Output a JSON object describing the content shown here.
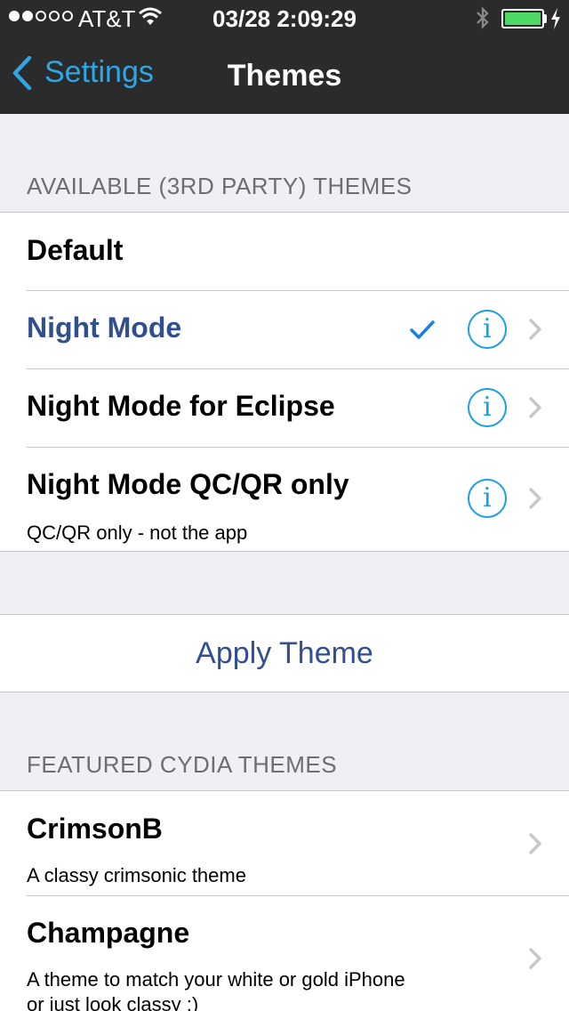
{
  "status": {
    "carrier": "AT&T",
    "time": "03/28 2:09:29",
    "signal_bars_filled": 2,
    "signal_bars_total": 5,
    "battery_level": 1.0
  },
  "nav": {
    "back_label": "Settings",
    "title": "Themes"
  },
  "available": {
    "header": "AVAILABLE (3RD PARTY) THEMES",
    "items": [
      {
        "title": "Default",
        "subtitle": "",
        "selected": false,
        "info": false
      },
      {
        "title": "Night Mode",
        "subtitle": "",
        "selected": true,
        "info": true
      },
      {
        "title": "Night Mode for Eclipse",
        "subtitle": "",
        "selected": false,
        "info": true
      },
      {
        "title": "Night Mode QC/QR only",
        "subtitle": "QC/QR only - not the app",
        "selected": false,
        "info": true
      }
    ]
  },
  "apply": {
    "label": "Apply Theme"
  },
  "featured": {
    "header": "FEATURED CYDIA THEMES",
    "items": [
      {
        "title": "CrimsonB",
        "subtitle": "A classy crimsonic theme"
      },
      {
        "title": "Champagne",
        "subtitle_line1": "A theme to match your white or gold iPhone",
        "subtitle_line2": "or just look classy ;)"
      }
    ]
  },
  "colors": {
    "bar_bg": "#2b2b2b",
    "accent_blue": "#2ea7e6",
    "selected_text": "#2f4f8f",
    "battery_green": "#4cd964",
    "page_bg": "#efeff4"
  },
  "icons": [
    "wifi-icon",
    "bluetooth-icon",
    "battery-icon",
    "charging-bolt-icon",
    "back-chevron-icon",
    "checkmark-icon",
    "info-icon",
    "chevron-right-icon"
  ]
}
